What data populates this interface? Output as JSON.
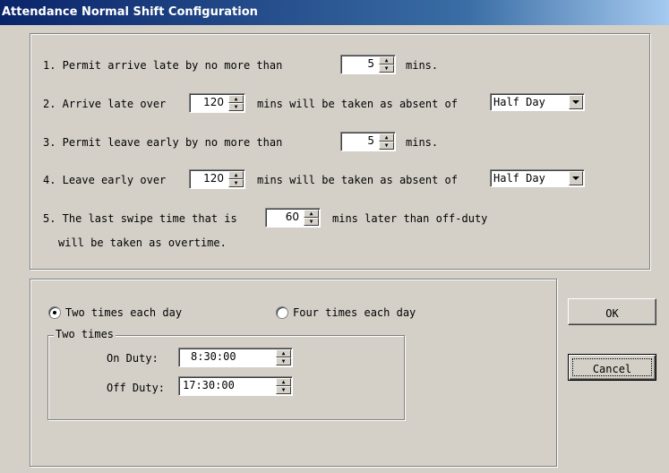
{
  "window": {
    "title": "Attendance Normal Shift Configuration"
  },
  "rules": {
    "r1": {
      "text": "1. Permit arrive late by no more than",
      "value": "5",
      "unit": "mins."
    },
    "r2": {
      "text": "2. Arrive late over",
      "value": "120",
      "mid": "mins will be taken as absent of",
      "option": "Half Day"
    },
    "r3": {
      "text": "3. Permit leave early by no more than",
      "value": "5",
      "unit": "mins."
    },
    "r4": {
      "text": "4. Leave early over",
      "value": "120",
      "mid": "mins will be taken as absent of",
      "option": "Half Day"
    },
    "r5": {
      "text": "5. The last swipe time that is",
      "value": "60",
      "mid": "mins later than off-duty",
      "line2": "will be taken as overtime."
    }
  },
  "swipe": {
    "option_two": "Two times each day",
    "option_four": "Four times each day",
    "selected": "two",
    "group_title": "Two times",
    "on_duty_label": "On Duty:",
    "on_duty_value": "8:30:00",
    "off_duty_label": "Off Duty:",
    "off_duty_value": "17:30:00"
  },
  "buttons": {
    "ok": "OK",
    "cancel": "Cancel"
  },
  "icons": {
    "spin": "spin-updown-icon",
    "dropdown": "chevron-down-icon",
    "radio": "radio-icon"
  }
}
